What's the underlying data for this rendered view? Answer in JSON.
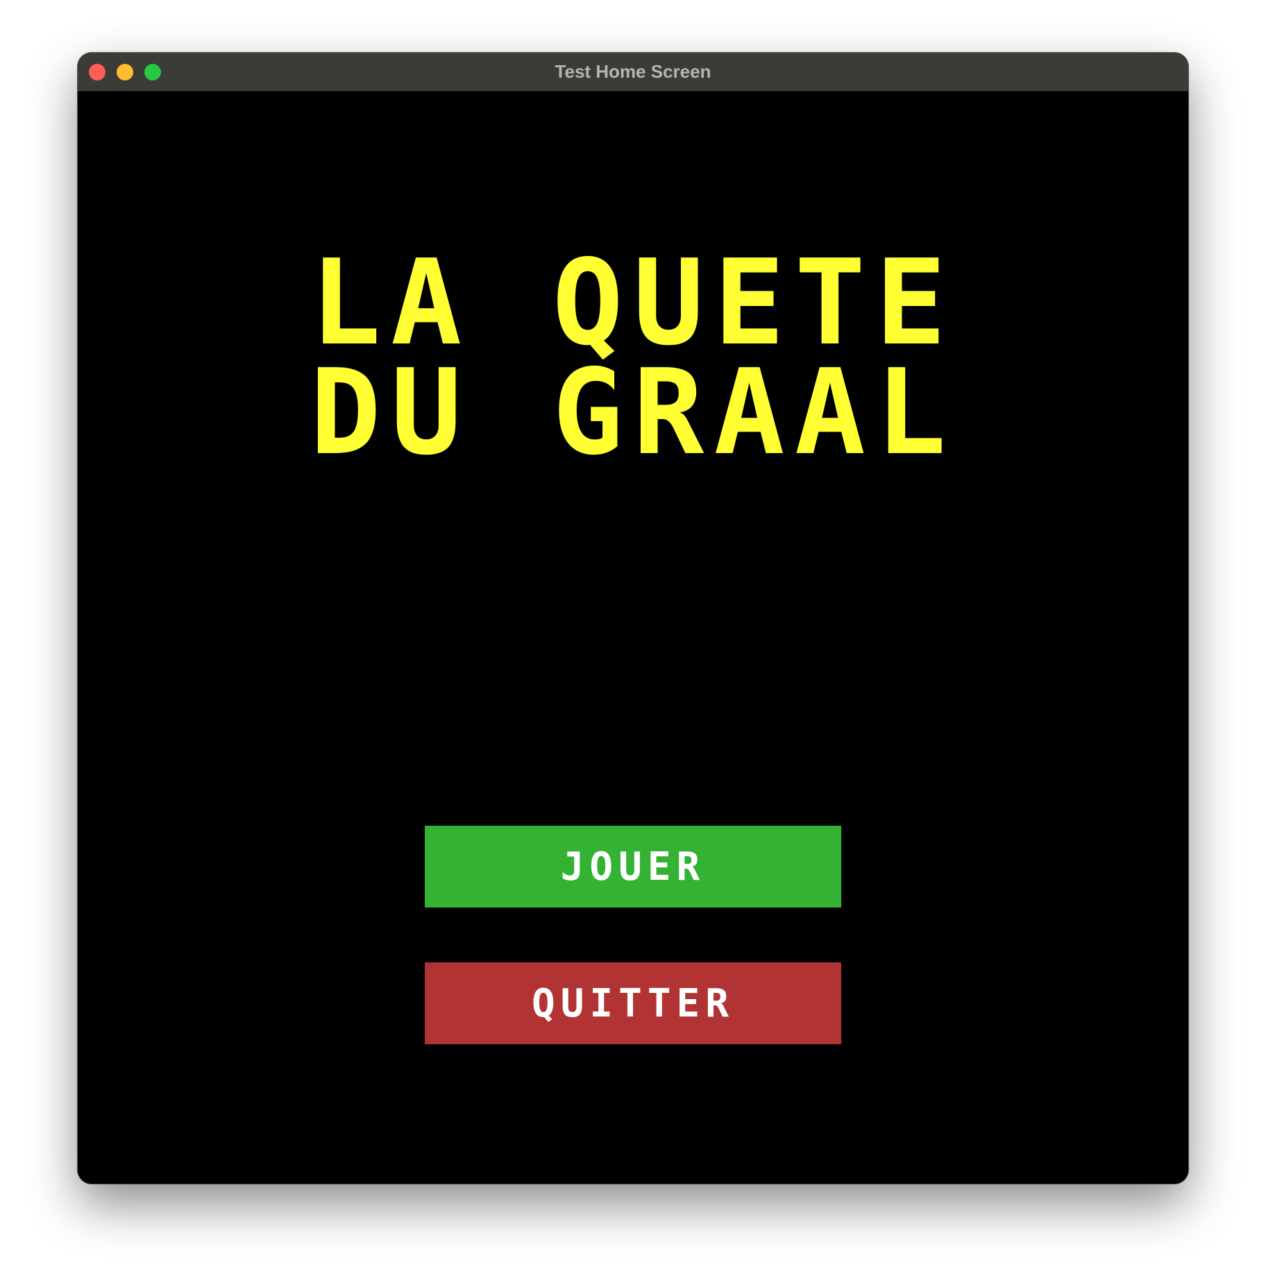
{
  "window": {
    "title": "Test Home Screen"
  },
  "game": {
    "title_line_1": "LA QUETE",
    "title_line_2": "DU GRAAL",
    "play_label": "JOUER",
    "quit_label": "QUITTER"
  },
  "colors": {
    "background": "#000000",
    "title": "#ffff33",
    "play_button": "#33b233",
    "quit_button": "#b23333",
    "button_text": "#ffffff"
  }
}
